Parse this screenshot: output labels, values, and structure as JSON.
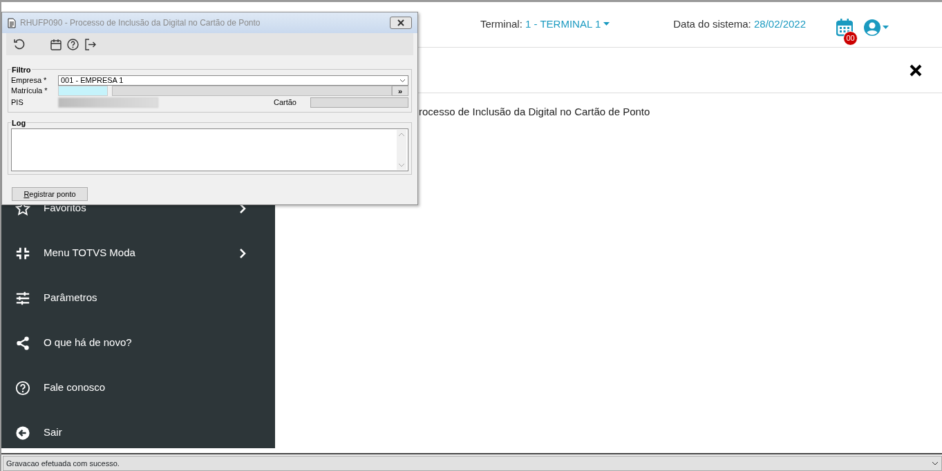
{
  "header": {
    "terminal_label": "Terminal:",
    "terminal_value": "1 - TERMINAL 1",
    "date_label": "Data do sistema:",
    "date_value": "28/02/2022",
    "notification_count": "00"
  },
  "page": {
    "text": "rocesso de Inclusão da Digital no Cartão de Ponto"
  },
  "sidebar": {
    "items": [
      {
        "label": "Favoritos",
        "has_submenu": true
      },
      {
        "label": "Menu TOTVS Moda",
        "has_submenu": true
      },
      {
        "label": "Parâmetros",
        "has_submenu": false
      },
      {
        "label": "O que há de novo?",
        "has_submenu": false
      },
      {
        "label": "Fale conosco",
        "has_submenu": false
      },
      {
        "label": "Sair",
        "has_submenu": false
      }
    ]
  },
  "dialog": {
    "title": "RHUFP090 - Processo de Inclusão da Digital no Cartão de Ponto",
    "filter": {
      "legend": "Filtro",
      "empresa_label": "Empresa *",
      "empresa_value": "001 - EMPRESA 1",
      "matricula_label": "Matrícula *",
      "lookup_button": "»",
      "pis_label": "PIS",
      "cartao_label": "Cartão"
    },
    "log": {
      "legend": "Log"
    },
    "button": "Registrar ponto"
  },
  "status_bar": {
    "message": "Gravacao efetuada com sucesso."
  }
}
